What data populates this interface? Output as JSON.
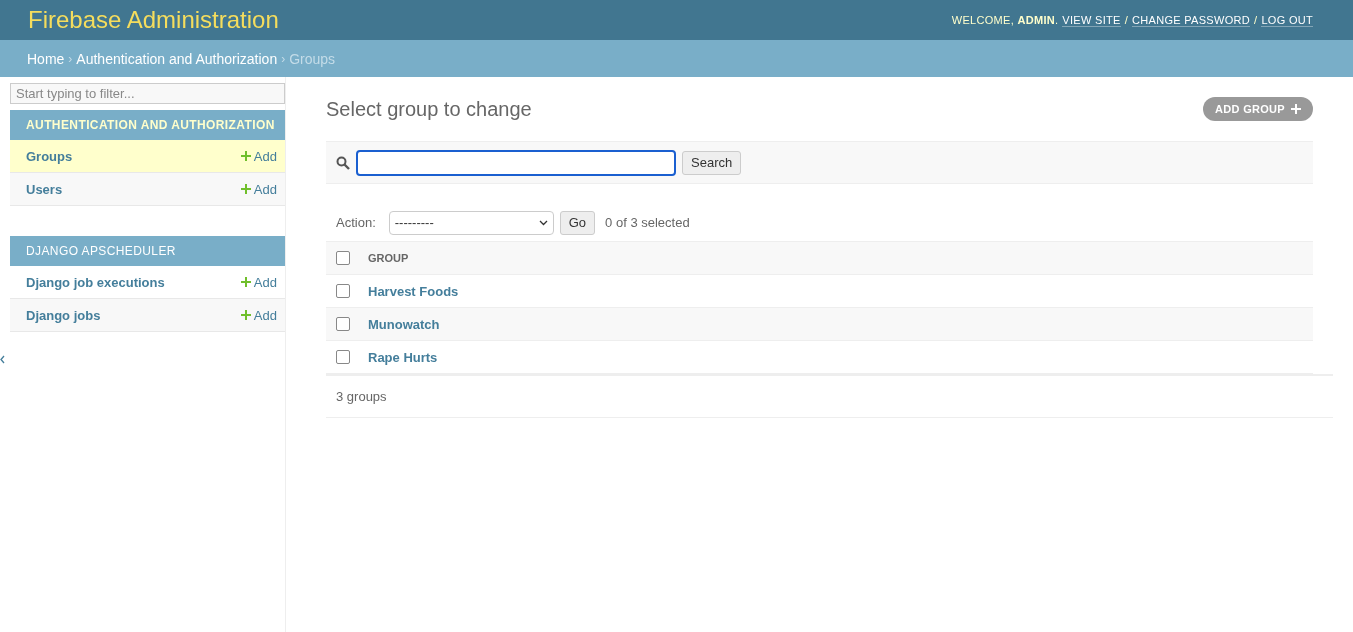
{
  "header": {
    "title": "Firebase Administration",
    "welcome": "WELCOME, **ADMIN**.",
    "links": [
      {
        "label": "VIEW SITE"
      },
      {
        "label": "CHANGE PASSWORD"
      },
      {
        "label": "LOG OUT"
      }
    ],
    "separator": "/"
  },
  "breadcrumbs": [
    {
      "label": "Home",
      "current": false
    },
    {
      "label": "Authentication and Authorization",
      "current": false
    },
    {
      "label": "Groups",
      "current": true
    }
  ],
  "breadcrumb_separator": "›",
  "sidebar": {
    "filter": {
      "placeholder": "Start typing to filter..."
    },
    "apps": [
      {
        "caption": "AUTHENTICATION AND AUTHORIZATION",
        "selected": true,
        "models": [
          {
            "label": "Groups",
            "add": "Add",
            "selected": true
          },
          {
            "label": "Users",
            "add": "Add",
            "selected": false
          }
        ]
      },
      {
        "caption": "DJANGO APSCHEDULER",
        "selected": false,
        "models": [
          {
            "label": "Django job executions",
            "add": "Add",
            "selected": false
          },
          {
            "label": "Django jobs",
            "add": "Add",
            "selected": false
          }
        ]
      }
    ]
  },
  "content": {
    "title": "Select group to change",
    "add_button": "ADD GROUP",
    "search": {
      "focused": true,
      "button": "Search"
    },
    "actions": {
      "label": "Action:",
      "select": "---------",
      "go": "Go",
      "counter": "0 of 3 selected"
    },
    "table": {
      "select_all": false,
      "columns": [
        {
          "label": "GROUP"
        }
      ],
      "rows": [
        {
          "name": "Harvest Foods",
          "checked": false
        },
        {
          "name": "Munowatch",
          "checked": false
        },
        {
          "name": "Rape Hurts",
          "checked": false
        }
      ]
    },
    "paginator": "3 groups"
  }
}
